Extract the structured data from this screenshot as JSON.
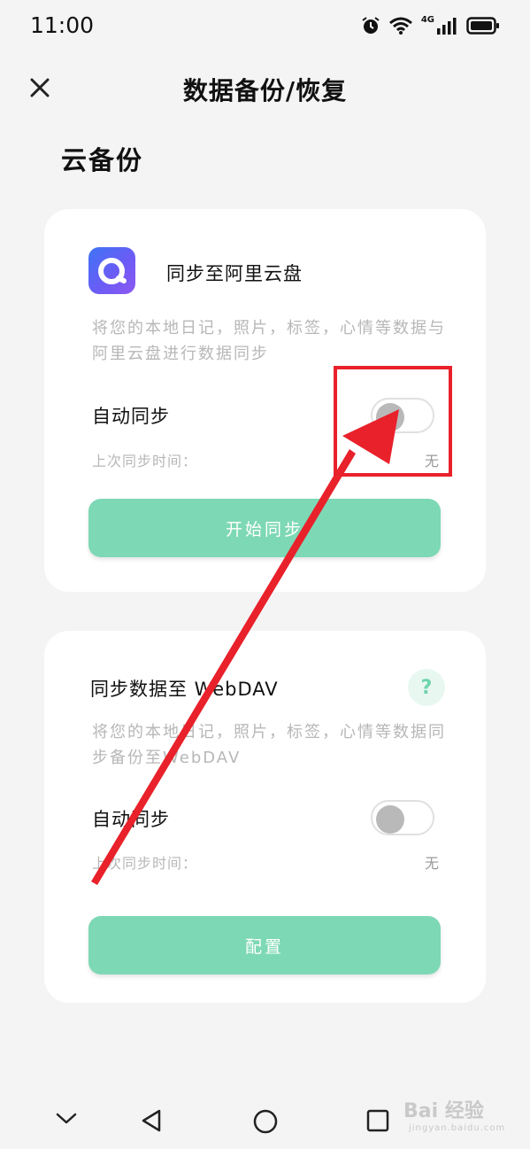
{
  "status_bar": {
    "time": "11:00",
    "network": "4G",
    "icons": [
      "alarm-icon",
      "wifi-icon",
      "signal-icon",
      "battery-icon"
    ]
  },
  "header": {
    "title": "数据备份/恢复",
    "close_icon": "close-icon"
  },
  "section": {
    "title": "云备份"
  },
  "aliyun_card": {
    "heading": "同步至阿里云盘",
    "description": "将您的本地日记，照片，标签，心情等数据与阿里云盘进行数据同步",
    "auto_sync_label": "自动同步",
    "auto_sync_on": false,
    "last_sync_label": "上次同步时间：",
    "last_sync_value": "无",
    "button_label": "开始同步"
  },
  "webdav_card": {
    "heading": "同步数据至 WebDAV",
    "description": "将您的本地日记，照片，标签，心情等数据同步备份至WebDAV",
    "help_label": "?",
    "auto_sync_label": "自动同步",
    "auto_sync_on": false,
    "last_sync_label": "上次同步时间：",
    "last_sync_value": "无",
    "button_label": "配置"
  },
  "nav_bar": {
    "items": [
      "chevron-down-icon",
      "back-icon",
      "home-icon",
      "recents-icon"
    ]
  },
  "watermark": {
    "text": "Bai 经验",
    "sub": "jingyan.baidu.com"
  },
  "colors": {
    "accent": "#7dd8b5",
    "annotation": "#e8212b",
    "background": "#f4f4f4"
  }
}
